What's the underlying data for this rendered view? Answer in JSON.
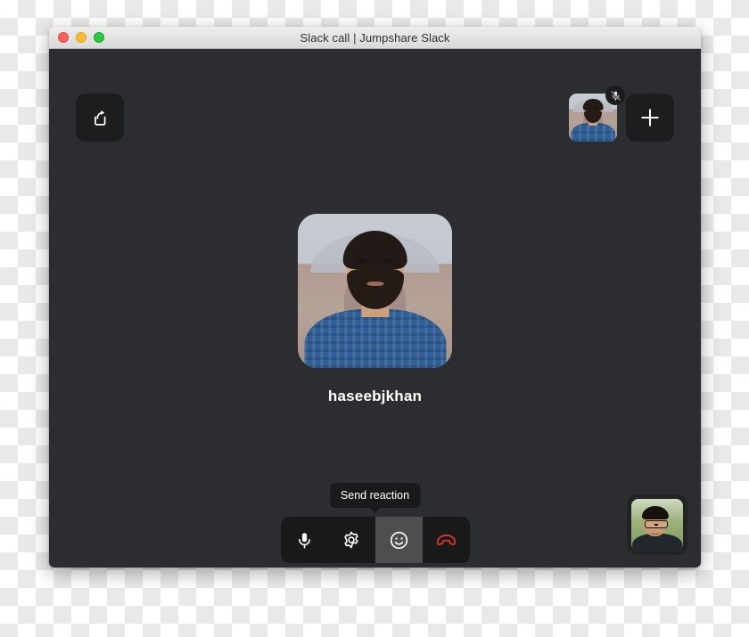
{
  "window": {
    "title": "Slack call | Jumpshare Slack",
    "traffic_lights": [
      {
        "name": "close",
        "color": "#ff5f57"
      },
      {
        "name": "minimize",
        "color": "#ffbd2e"
      },
      {
        "name": "maximize",
        "color": "#28c840"
      }
    ]
  },
  "stage": {
    "background_color": "#2c2d31",
    "share_button": {
      "icon": "share-export-icon"
    },
    "add_participant_button": {
      "icon": "plus-icon"
    },
    "participant_thumbnail": {
      "icon_badge": "microphone-muted-icon",
      "muted": true
    },
    "main_speaker": {
      "name": "haseebjkhan",
      "avatar_alt": "bearded man in blue plaid shirt"
    },
    "self_view": {
      "alt": "person wearing glasses outdoors"
    }
  },
  "tooltip": {
    "text": "Send reaction"
  },
  "controls": {
    "background_color": "#191919",
    "hover_color": "#4e4e4e",
    "hangup_color": "#d0342c",
    "buttons": [
      {
        "name": "microphone",
        "icon": "microphone-icon",
        "hovered": false
      },
      {
        "name": "settings",
        "icon": "gear-icon",
        "hovered": false
      },
      {
        "name": "send-reaction",
        "icon": "smiley-face-icon",
        "hovered": true
      },
      {
        "name": "hang-up",
        "icon": "phone-hangup-icon",
        "hovered": false
      }
    ]
  }
}
